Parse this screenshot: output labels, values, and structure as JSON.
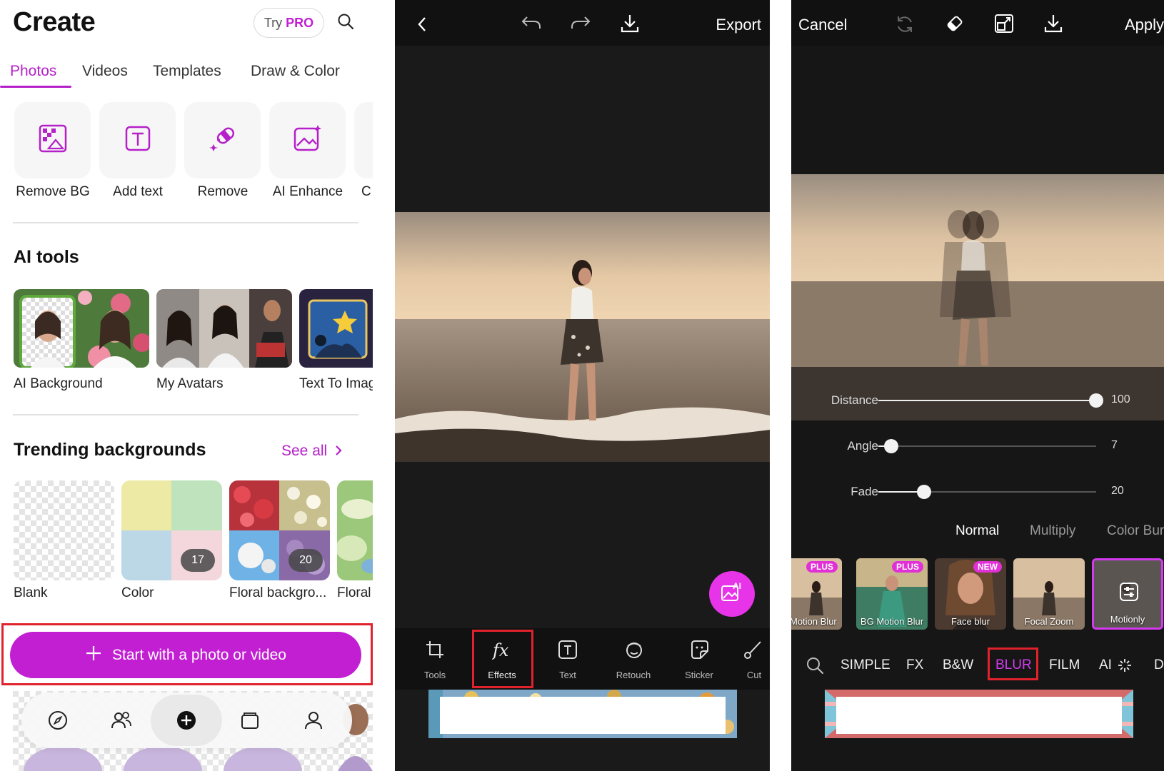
{
  "panel_create": {
    "title": "Create",
    "try_label": "Try",
    "pro_label": "PRO",
    "tabs": [
      "Photos",
      "Videos",
      "Templates",
      "Draw & Color"
    ],
    "quick_tools": [
      "Remove BG",
      "Add text",
      "Remove",
      "AI Enhance",
      "C"
    ],
    "ai_tools_title": "AI tools",
    "ai_tools": [
      "AI Background",
      "My Avatars",
      "Text To Imag"
    ],
    "trending_title": "Trending backgrounds",
    "see_all": "See all",
    "backgrounds": [
      {
        "label": "Blank",
        "count": ""
      },
      {
        "label": "Color",
        "count": "17"
      },
      {
        "label": "Floral backgro...",
        "count": "20"
      },
      {
        "label": "Floral",
        "count": ""
      }
    ],
    "cta_label": "Start with a photo or video",
    "nav_icons": [
      "discover-icon",
      "community-icon",
      "add-icon",
      "projects-icon",
      "profile-icon"
    ],
    "accent": "#c21fd3"
  },
  "panel_editor": {
    "export_label": "Export",
    "tools": [
      "Tools",
      "Effects",
      "Text",
      "Retouch",
      "Sticker",
      "Cut"
    ],
    "highlight": "Effects",
    "ai_fab_label": "AI"
  },
  "panel_effects": {
    "cancel_label": "Cancel",
    "apply_label": "Apply",
    "sliders": [
      {
        "label": "Distance",
        "value": 100,
        "level": 1.0
      },
      {
        "label": "Angle",
        "value": 7,
        "level": 0.06
      },
      {
        "label": "Fade",
        "value": 20,
        "level": 0.21
      }
    ],
    "blend_modes": [
      "Normal",
      "Multiply",
      "Color Bur"
    ],
    "active_blend": "Normal",
    "effects": [
      {
        "name": "Motion Blur",
        "badge": "PLUS"
      },
      {
        "name": "BG Motion Blur",
        "badge": "PLUS"
      },
      {
        "name": "Face blur",
        "badge": "NEW"
      },
      {
        "name": "Focal Zoom",
        "badge": ""
      },
      {
        "name": "Motionly",
        "badge": ""
      }
    ],
    "categories": [
      "SIMPLE",
      "FX",
      "B&W",
      "BLUR",
      "FILM",
      "AI",
      "D"
    ],
    "active_category": "BLUR"
  }
}
